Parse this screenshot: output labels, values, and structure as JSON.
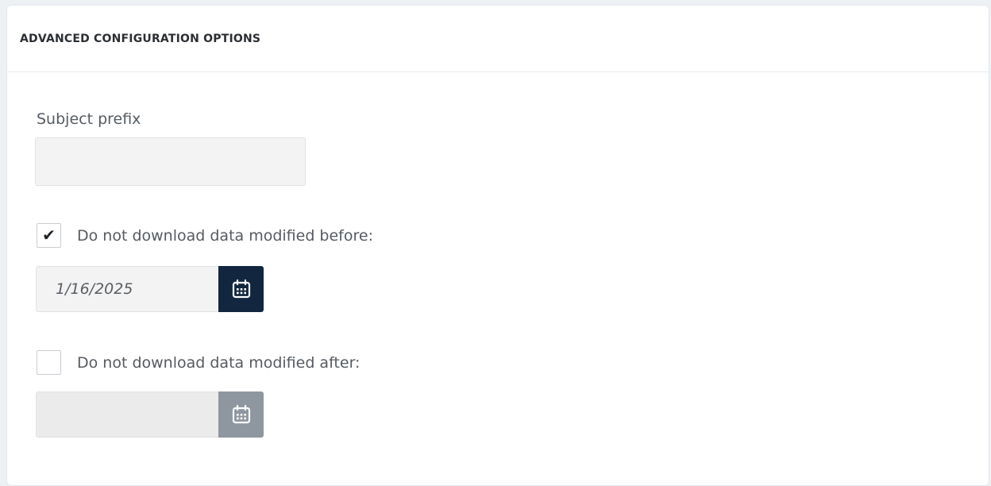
{
  "panel": {
    "title": "ADVANCED CONFIGURATION OPTIONS"
  },
  "subject_prefix": {
    "label": "Subject prefix",
    "value": ""
  },
  "modified_before": {
    "checked": true,
    "check_glyph": "✔",
    "label": "Do not download data modified before:",
    "date_value": "1/16/2025",
    "calendar_icon": "calendar-icon",
    "button_color": "#12273f"
  },
  "modified_after": {
    "checked": false,
    "check_glyph": "",
    "label": "Do not download data modified after:",
    "date_value": "",
    "calendar_icon": "calendar-icon",
    "button_color": "#8e979f"
  }
}
